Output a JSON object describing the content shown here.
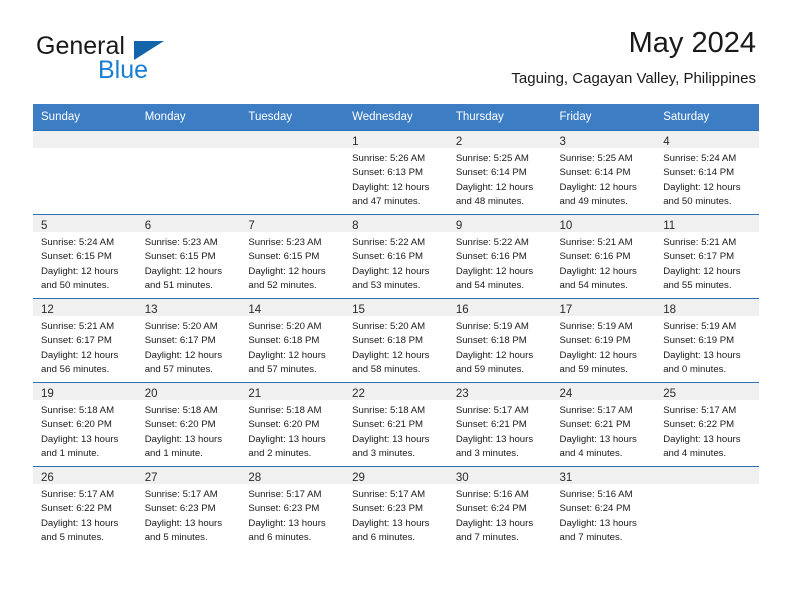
{
  "logo": {
    "word_one": "General",
    "word_two": "Blue",
    "triangle_color": "#1464aa",
    "blue_text_color": "#1a7fd4"
  },
  "header": {
    "title": "May 2024",
    "subtitle": "Taguing, Cagayan Valley, Philippines"
  },
  "theme": {
    "header_bg": "#3c7dc4",
    "header_text": "#ffffff",
    "daynum_bg": "#f0f0f0",
    "grid_line": "#2f6fb5"
  },
  "weekdays": [
    "Sunday",
    "Monday",
    "Tuesday",
    "Wednesday",
    "Thursday",
    "Friday",
    "Saturday"
  ],
  "weeks": [
    [
      {
        "day": "",
        "lines": []
      },
      {
        "day": "",
        "lines": []
      },
      {
        "day": "",
        "lines": []
      },
      {
        "day": "1",
        "lines": [
          "Sunrise: 5:26 AM",
          "Sunset: 6:13 PM",
          "Daylight: 12 hours",
          "and 47 minutes."
        ]
      },
      {
        "day": "2",
        "lines": [
          "Sunrise: 5:25 AM",
          "Sunset: 6:14 PM",
          "Daylight: 12 hours",
          "and 48 minutes."
        ]
      },
      {
        "day": "3",
        "lines": [
          "Sunrise: 5:25 AM",
          "Sunset: 6:14 PM",
          "Daylight: 12 hours",
          "and 49 minutes."
        ]
      },
      {
        "day": "4",
        "lines": [
          "Sunrise: 5:24 AM",
          "Sunset: 6:14 PM",
          "Daylight: 12 hours",
          "and 50 minutes."
        ]
      }
    ],
    [
      {
        "day": "5",
        "lines": [
          "Sunrise: 5:24 AM",
          "Sunset: 6:15 PM",
          "Daylight: 12 hours",
          "and 50 minutes."
        ]
      },
      {
        "day": "6",
        "lines": [
          "Sunrise: 5:23 AM",
          "Sunset: 6:15 PM",
          "Daylight: 12 hours",
          "and 51 minutes."
        ]
      },
      {
        "day": "7",
        "lines": [
          "Sunrise: 5:23 AM",
          "Sunset: 6:15 PM",
          "Daylight: 12 hours",
          "and 52 minutes."
        ]
      },
      {
        "day": "8",
        "lines": [
          "Sunrise: 5:22 AM",
          "Sunset: 6:16 PM",
          "Daylight: 12 hours",
          "and 53 minutes."
        ]
      },
      {
        "day": "9",
        "lines": [
          "Sunrise: 5:22 AM",
          "Sunset: 6:16 PM",
          "Daylight: 12 hours",
          "and 54 minutes."
        ]
      },
      {
        "day": "10",
        "lines": [
          "Sunrise: 5:21 AM",
          "Sunset: 6:16 PM",
          "Daylight: 12 hours",
          "and 54 minutes."
        ]
      },
      {
        "day": "11",
        "lines": [
          "Sunrise: 5:21 AM",
          "Sunset: 6:17 PM",
          "Daylight: 12 hours",
          "and 55 minutes."
        ]
      }
    ],
    [
      {
        "day": "12",
        "lines": [
          "Sunrise: 5:21 AM",
          "Sunset: 6:17 PM",
          "Daylight: 12 hours",
          "and 56 minutes."
        ]
      },
      {
        "day": "13",
        "lines": [
          "Sunrise: 5:20 AM",
          "Sunset: 6:17 PM",
          "Daylight: 12 hours",
          "and 57 minutes."
        ]
      },
      {
        "day": "14",
        "lines": [
          "Sunrise: 5:20 AM",
          "Sunset: 6:18 PM",
          "Daylight: 12 hours",
          "and 57 minutes."
        ]
      },
      {
        "day": "15",
        "lines": [
          "Sunrise: 5:20 AM",
          "Sunset: 6:18 PM",
          "Daylight: 12 hours",
          "and 58 minutes."
        ]
      },
      {
        "day": "16",
        "lines": [
          "Sunrise: 5:19 AM",
          "Sunset: 6:18 PM",
          "Daylight: 12 hours",
          "and 59 minutes."
        ]
      },
      {
        "day": "17",
        "lines": [
          "Sunrise: 5:19 AM",
          "Sunset: 6:19 PM",
          "Daylight: 12 hours",
          "and 59 minutes."
        ]
      },
      {
        "day": "18",
        "lines": [
          "Sunrise: 5:19 AM",
          "Sunset: 6:19 PM",
          "Daylight: 13 hours",
          "and 0 minutes."
        ]
      }
    ],
    [
      {
        "day": "19",
        "lines": [
          "Sunrise: 5:18 AM",
          "Sunset: 6:20 PM",
          "Daylight: 13 hours",
          "and 1 minute."
        ]
      },
      {
        "day": "20",
        "lines": [
          "Sunrise: 5:18 AM",
          "Sunset: 6:20 PM",
          "Daylight: 13 hours",
          "and 1 minute."
        ]
      },
      {
        "day": "21",
        "lines": [
          "Sunrise: 5:18 AM",
          "Sunset: 6:20 PM",
          "Daylight: 13 hours",
          "and 2 minutes."
        ]
      },
      {
        "day": "22",
        "lines": [
          "Sunrise: 5:18 AM",
          "Sunset: 6:21 PM",
          "Daylight: 13 hours",
          "and 3 minutes."
        ]
      },
      {
        "day": "23",
        "lines": [
          "Sunrise: 5:17 AM",
          "Sunset: 6:21 PM",
          "Daylight: 13 hours",
          "and 3 minutes."
        ]
      },
      {
        "day": "24",
        "lines": [
          "Sunrise: 5:17 AM",
          "Sunset: 6:21 PM",
          "Daylight: 13 hours",
          "and 4 minutes."
        ]
      },
      {
        "day": "25",
        "lines": [
          "Sunrise: 5:17 AM",
          "Sunset: 6:22 PM",
          "Daylight: 13 hours",
          "and 4 minutes."
        ]
      }
    ],
    [
      {
        "day": "26",
        "lines": [
          "Sunrise: 5:17 AM",
          "Sunset: 6:22 PM",
          "Daylight: 13 hours",
          "and 5 minutes."
        ]
      },
      {
        "day": "27",
        "lines": [
          "Sunrise: 5:17 AM",
          "Sunset: 6:23 PM",
          "Daylight: 13 hours",
          "and 5 minutes."
        ]
      },
      {
        "day": "28",
        "lines": [
          "Sunrise: 5:17 AM",
          "Sunset: 6:23 PM",
          "Daylight: 13 hours",
          "and 6 minutes."
        ]
      },
      {
        "day": "29",
        "lines": [
          "Sunrise: 5:17 AM",
          "Sunset: 6:23 PM",
          "Daylight: 13 hours",
          "and 6 minutes."
        ]
      },
      {
        "day": "30",
        "lines": [
          "Sunrise: 5:16 AM",
          "Sunset: 6:24 PM",
          "Daylight: 13 hours",
          "and 7 minutes."
        ]
      },
      {
        "day": "31",
        "lines": [
          "Sunrise: 5:16 AM",
          "Sunset: 6:24 PM",
          "Daylight: 13 hours",
          "and 7 minutes."
        ]
      },
      {
        "day": "",
        "lines": []
      }
    ]
  ]
}
